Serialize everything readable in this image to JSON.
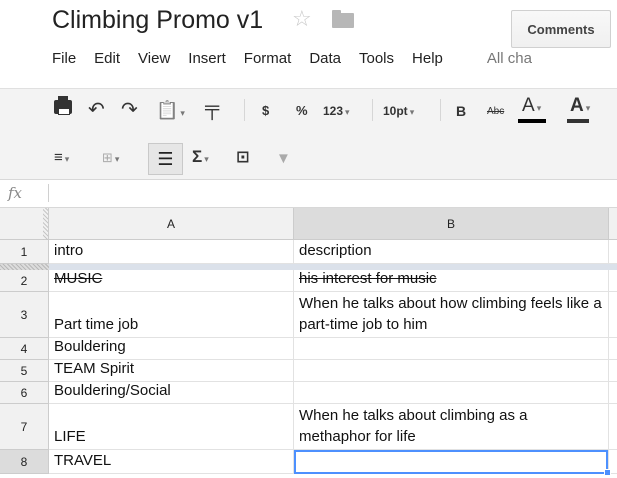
{
  "document": {
    "title": "Climbing Promo v1"
  },
  "header": {
    "comments_label": "Comments",
    "star_icon": "☆"
  },
  "menubar": {
    "items": [
      "File",
      "Edit",
      "View",
      "Insert",
      "Format",
      "Data",
      "Tools",
      "Help"
    ],
    "status": "All cha"
  },
  "toolbar": {
    "undo": "↶",
    "redo": "↷",
    "paste": "📋",
    "paint_format": "▀▌",
    "currency": "$",
    "percent": "%",
    "number_format": "123",
    "font_size": "10pt",
    "bold": "B",
    "strikethrough": "Abc",
    "text_color": "A",
    "fill_color": "A",
    "align": "≡",
    "merge": "⊞",
    "wrap": "⤶",
    "sum": "Σ",
    "chart": "⊡",
    "filter": "▼",
    "caret": "▾"
  },
  "formula_bar": {
    "fx": "fx"
  },
  "grid": {
    "columns": [
      "A",
      "B"
    ],
    "rows": [
      {
        "num": "1",
        "a": "intro",
        "b": ""
      },
      {
        "num": "2",
        "a": "MUSIC",
        "b": "his interest for music"
      },
      {
        "num": "3",
        "a": "Part time job",
        "b": "When he talks about how climbing feels like a part-time job to him"
      },
      {
        "num": "4",
        "a": "Bouldering",
        "b": ""
      },
      {
        "num": "5",
        "a": "TEAM Spirit",
        "b": ""
      },
      {
        "num": "6",
        "a": "Bouldering/Social",
        "b": ""
      },
      {
        "num": "7",
        "a": "LIFE",
        "b": "When he talks about climbing as a methaphor for life"
      },
      {
        "num": "8",
        "a": "TRAVEL",
        "b": ""
      }
    ],
    "header_row_b": "description",
    "selected_cell": "B8"
  },
  "colors": {
    "selection": "#4d90fe",
    "toolbar_bg": "#f3f3f3",
    "header_bg": "#f1f1f1"
  }
}
